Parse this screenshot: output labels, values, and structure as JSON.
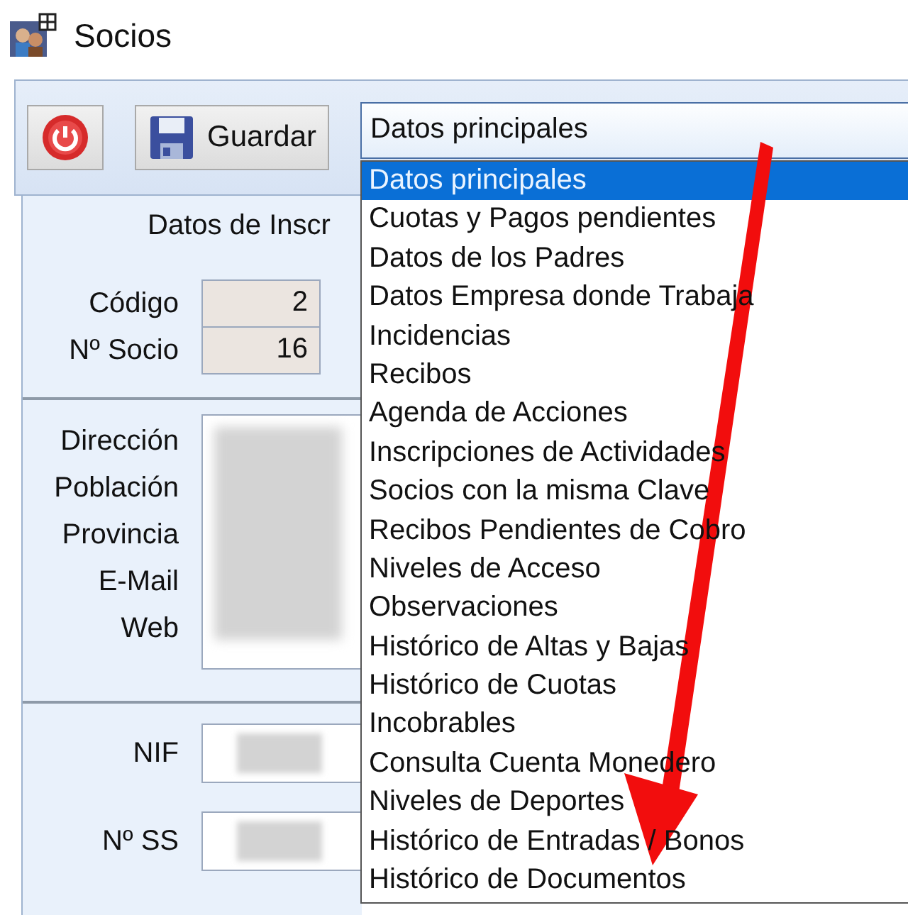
{
  "window": {
    "title": "Socios"
  },
  "toolbar": {
    "buttons": [
      {
        "kind": "power"
      },
      {
        "kind": "save",
        "label": "Guardar"
      }
    ]
  },
  "section_select": {
    "value": "Datos principales",
    "expanded": true,
    "options": [
      {
        "label": "Datos principales",
        "selected": true
      },
      {
        "label": "Cuotas y Pagos pendientes",
        "selected": false
      },
      {
        "label": "Datos de los Padres",
        "selected": false
      },
      {
        "label": "Datos Empresa donde Trabaja",
        "selected": false
      },
      {
        "label": "Incidencias",
        "selected": false
      },
      {
        "label": "Recibos",
        "selected": false
      },
      {
        "label": "Agenda de Acciones",
        "selected": false
      },
      {
        "label": "Inscripciones de Actividades",
        "selected": false
      },
      {
        "label": "Socios con la misma Clave",
        "selected": false
      },
      {
        "label": "Recibos Pendientes de Cobro",
        "selected": false
      },
      {
        "label": "Niveles de Acceso",
        "selected": false
      },
      {
        "label": "Observaciones",
        "selected": false
      },
      {
        "label": "Histórico de Altas y Bajas",
        "selected": false
      },
      {
        "label": "Histórico de Cuotas",
        "selected": false
      },
      {
        "label": "Incobrables",
        "selected": false
      },
      {
        "label": "Consulta Cuenta Monedero",
        "selected": false
      },
      {
        "label": "Niveles de Deportes",
        "selected": false
      },
      {
        "label": "Histórico de Entradas / Bonos",
        "selected": false
      },
      {
        "label": "Histórico de Documentos",
        "selected": false
      }
    ]
  },
  "form": {
    "heading": "Datos de Inscr",
    "id_fields": [
      {
        "label": "Código",
        "value": "2"
      },
      {
        "label": "Nº Socio",
        "value": "16"
      }
    ],
    "address_labels": [
      "Dirección",
      "Población",
      "Provincia",
      "E-Mail",
      "Web"
    ],
    "id_doc_fields": [
      {
        "label": "NIF"
      },
      {
        "label": "Nº SS"
      }
    ]
  },
  "annotation": {
    "kind": "arrow"
  }
}
